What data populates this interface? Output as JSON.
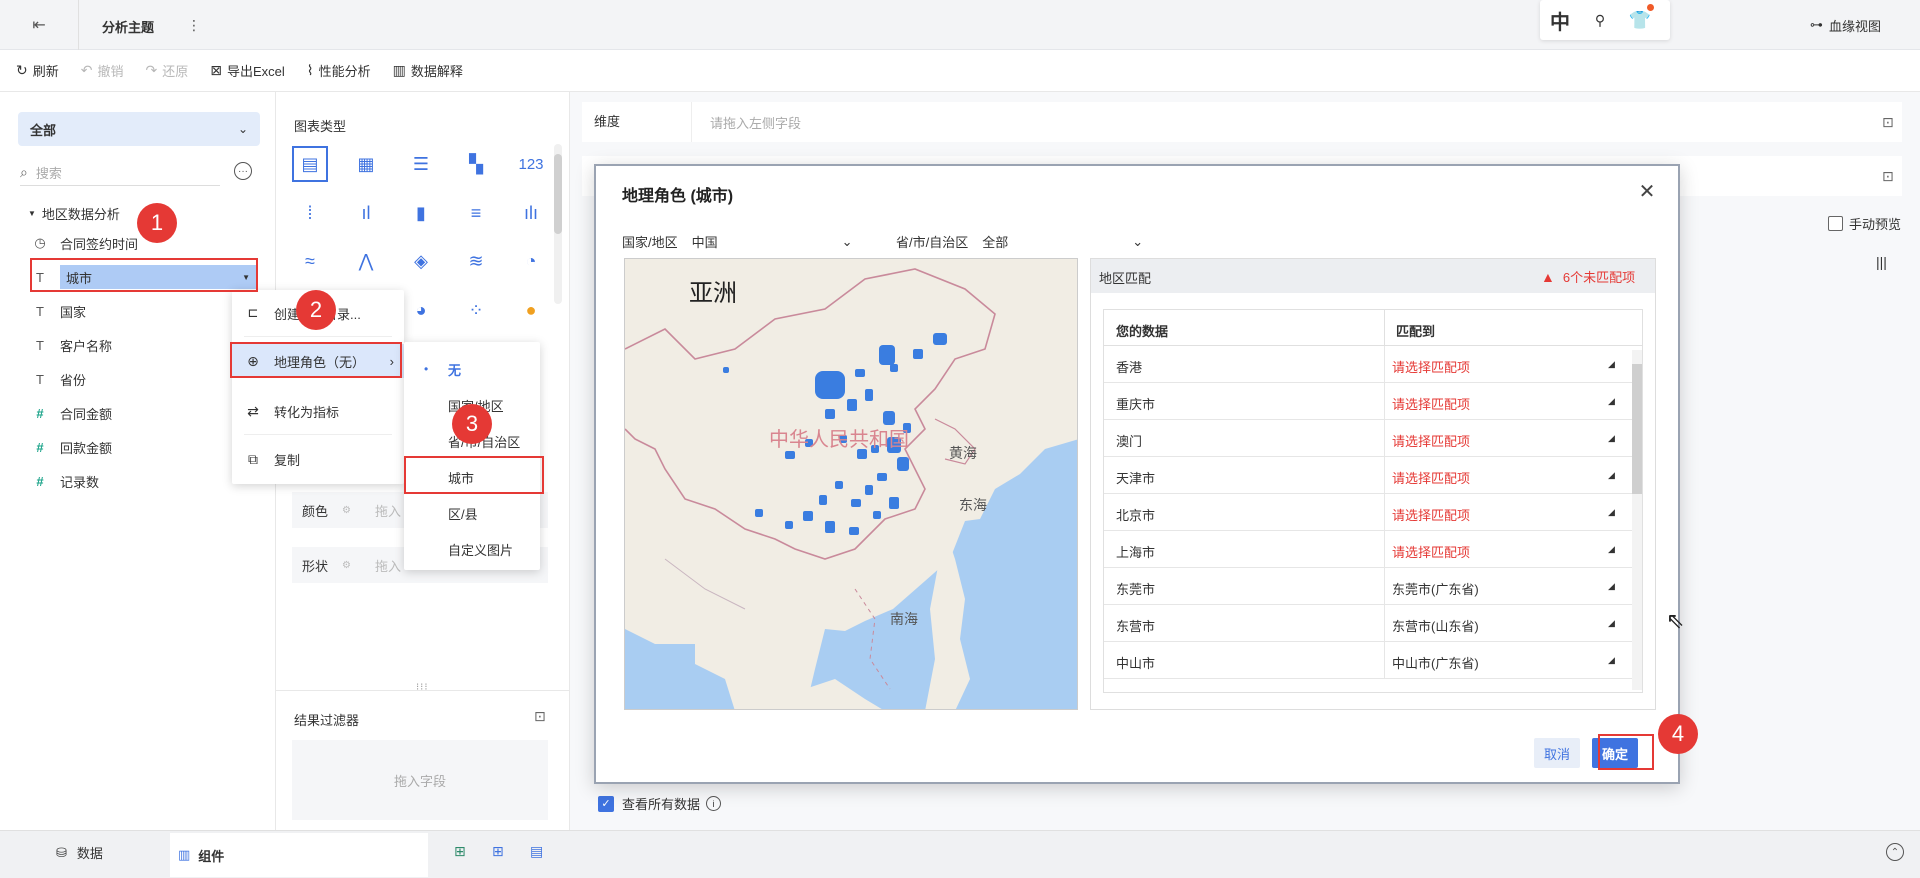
{
  "header": {
    "title": "分析主题",
    "lang_badge": "中",
    "lineage_label": "血缘视图"
  },
  "toolbar": {
    "refresh": "刷新",
    "undo": "撤销",
    "redo": "还原",
    "export": "导出Excel",
    "perf": "性能分析",
    "explain": "数据解释"
  },
  "left": {
    "scope": "全部",
    "search_placeholder": "搜索",
    "group": "地区数据分析",
    "fields": [
      {
        "label": "合同签约时间",
        "type": "time"
      },
      {
        "label": "城市",
        "type": "text"
      },
      {
        "label": "国家",
        "type": "text"
      },
      {
        "label": "客户名称",
        "type": "text"
      },
      {
        "label": "省份",
        "type": "text"
      },
      {
        "label": "合同金额",
        "type": "num"
      },
      {
        "label": "回款金额",
        "type": "num"
      },
      {
        "label": "记录数",
        "type": "num"
      }
    ]
  },
  "chart_panel": {
    "title": "图表类型",
    "color_label": "颜色",
    "shape_label": "形状",
    "drop_hint": "拖入",
    "filter_title": "结果过滤器",
    "filter_hint": "拖入字段"
  },
  "main": {
    "dimension_label": "维度",
    "dimension_hint": "请拖入左侧字段",
    "manual_preview": "手动预览",
    "view_all": "查看所有数据"
  },
  "context_menu": {
    "create": "创建",
    "create_suffix": "目录...",
    "geo_role": "地理角色（无）",
    "to_metric": "转化为指标",
    "copy": "复制"
  },
  "submenu": {
    "items": [
      "无",
      "国家/地区",
      "省/市/自治区",
      "城市",
      "区/县",
      "自定义图片"
    ]
  },
  "dialog": {
    "title": "地理角色 (城市)",
    "country_label": "国家/地区",
    "country_value": "中国",
    "province_label": "省/市/自治区",
    "province_value": "全部",
    "map_labels": {
      "continent": "亚洲",
      "country": "中华人民共和国",
      "sea1": "黄海",
      "sea2": "东海",
      "sea3": "南海"
    },
    "match_title": "地区匹配",
    "unmatched": "6个未匹配项",
    "col_data": "您的数据",
    "col_match": "匹配到",
    "rows": [
      {
        "data": "香港",
        "match": "请选择匹配项",
        "ok": false
      },
      {
        "data": "重庆市",
        "match": "请选择匹配项",
        "ok": false
      },
      {
        "data": "澳门",
        "match": "请选择匹配项",
        "ok": false
      },
      {
        "data": "天津市",
        "match": "请选择匹配项",
        "ok": false
      },
      {
        "data": "北京市",
        "match": "请选择匹配项",
        "ok": false
      },
      {
        "data": "上海市",
        "match": "请选择匹配项",
        "ok": false
      },
      {
        "data": "东莞市",
        "match": "东莞市(广东省)",
        "ok": true
      },
      {
        "data": "东营市",
        "match": "东营市(山东省)",
        "ok": true
      },
      {
        "data": "中山市",
        "match": "中山市(广东省)",
        "ok": true
      }
    ],
    "cancel": "取消",
    "confirm": "确定"
  },
  "steps": [
    "1",
    "2",
    "3",
    "4"
  ],
  "bottom": {
    "tab_data": "数据",
    "tab_component": "组件"
  },
  "colors": {
    "accent": "#3f73e0",
    "danger": "#e53935",
    "selected_field_bg": "#aecbf5"
  }
}
